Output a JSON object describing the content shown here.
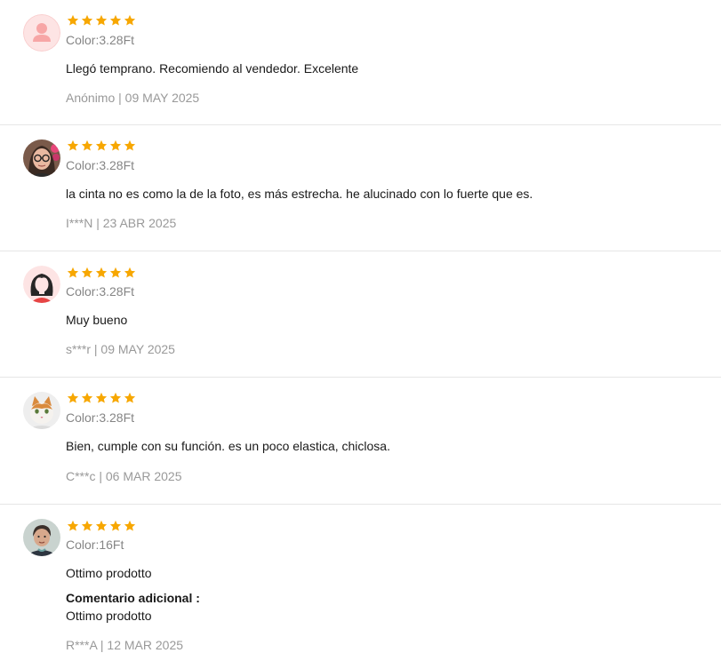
{
  "colors": {
    "star": "#f7a700",
    "divider": "#e6e6e6",
    "sku_text": "#858585",
    "meta_text": "#999999",
    "body_text": "#191919"
  },
  "reviews": [
    {
      "avatar_icon": "default-user-avatar-icon",
      "rating": 5,
      "sku": "Color:3.28Ft",
      "content": "Llegó temprano. Recomiendo al vendedor. Excelente",
      "author": "Anónimo",
      "date": "09 MAY 2025",
      "meta": "Anónimo | 09 MAY 2025"
    },
    {
      "avatar_icon": "woman-glasses-photo-avatar",
      "rating": 5,
      "sku": "Color:3.28Ft",
      "content": "la cinta no es como la de la foto, es más estrecha. he alucinado con lo fuerte que es.",
      "author": "I***N",
      "date": "23 ABR 2025",
      "meta": "I***N | 23 ABR 2025"
    },
    {
      "avatar_icon": "woman-illustration-avatar",
      "rating": 5,
      "sku": "Color:3.28Ft",
      "content": "Muy bueno",
      "author": "s***r",
      "date": "09 MAY 2025",
      "meta": "s***r | 09 MAY 2025"
    },
    {
      "avatar_icon": "cat-photo-avatar",
      "rating": 5,
      "sku": "Color:3.28Ft",
      "content": "Bien, cumple con su función. es un poco elastica, chiclosa.",
      "author": "C***c",
      "date": "06 MAR 2025",
      "meta": "C***c | 06 MAR 2025"
    },
    {
      "avatar_icon": "man-photo-avatar",
      "rating": 5,
      "sku": "Color:16Ft",
      "content": "Ottimo prodotto",
      "additional_title": "Comentario adicional :",
      "additional_content": "Ottimo prodotto",
      "author": "R***A",
      "date": "12 MAR 2025",
      "meta": "R***A | 12 MAR 2025"
    }
  ]
}
